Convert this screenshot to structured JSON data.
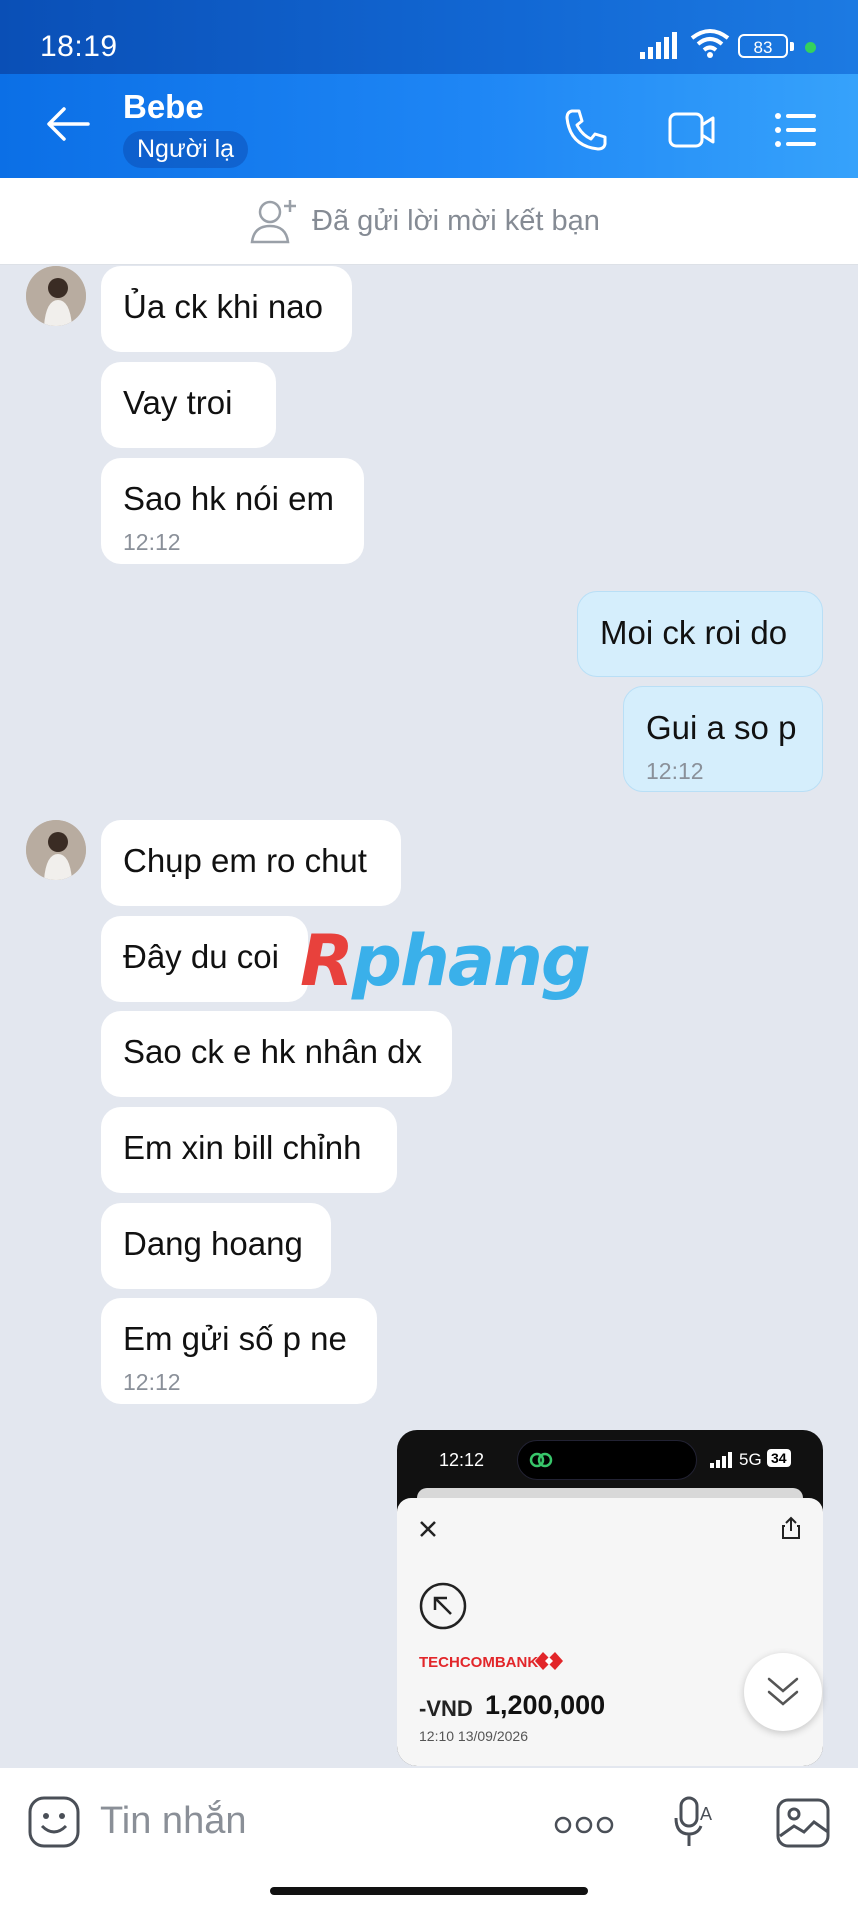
{
  "status": {
    "time": "18:19",
    "battery": "83"
  },
  "header": {
    "name": "Bebe",
    "tag": "Người lạ"
  },
  "friend_notice": "Đã gửi lời mời kết bạn",
  "messages": [
    {
      "text": "Ủa ck khi nao"
    },
    {
      "text": "Vay troi"
    },
    {
      "text": "Sao hk nói em",
      "time": "12:12"
    },
    {
      "text": "Moi ck roi do"
    },
    {
      "text": "Gui a so p",
      "time": "12:12"
    },
    {
      "text": "Chụp em ro chut"
    },
    {
      "text": "Đây du coi"
    },
    {
      "text": "Sao ck e hk nhân dx"
    },
    {
      "text": "Em xin bill chỉnh"
    },
    {
      "text": "Dang hoang"
    },
    {
      "text": "Em gửi số p ne",
      "time": "12:12"
    }
  ],
  "shared_image": {
    "time": "12:12",
    "network": "5G",
    "battery": "34",
    "bank": "TECHCOMBANK",
    "currency": "-VND",
    "amount": "1,200,000",
    "datetime": "12:10 13/09/2026"
  },
  "watermark": {
    "part1": "R",
    "part2": "phang"
  },
  "composer": {
    "placeholder": "Tin nhắn"
  },
  "colors": {
    "header_blue": "#1e86f5",
    "my_bubble": "#d5eefc",
    "background": "#e3e7ef"
  }
}
